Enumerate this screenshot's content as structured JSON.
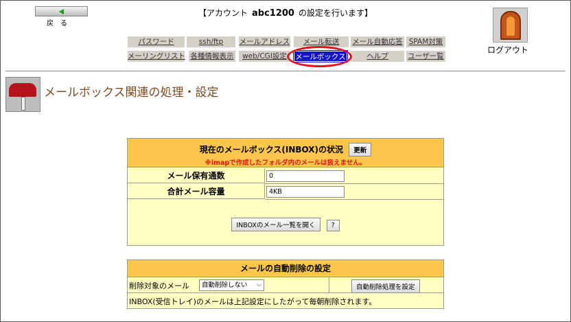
{
  "header": {
    "back_label": "戻る",
    "title_prefix": "【アカウント",
    "account": "abc1200",
    "title_suffix": "の設定を行います】",
    "logout_label": "ログアウト"
  },
  "nav": {
    "row1": [
      "パスワード",
      "ssh/ftp",
      "メールアドレス",
      "メール転送",
      "メール自動応答",
      "SPAM対策"
    ],
    "row2": [
      "メーリングリスト",
      "各種情報表示",
      "web/CGI設定",
      "メールボックス",
      "ヘルプ",
      "ユーザー覧"
    ]
  },
  "page": {
    "title": "メールボックス関連の処理・設定"
  },
  "status": {
    "title": "現在のメールボックス(INBOX)の状況",
    "refresh_label": "更新",
    "note": "※imapで作成したフォルダ内のメールは扱えません。",
    "count_label": "メール保有通数",
    "count_value": "0",
    "size_label": "合計メール容量",
    "size_value": "4KB",
    "list_button": "INBOXのメール一覧を開く",
    "help_button": "?"
  },
  "autodelete": {
    "title": "メールの自動削除の設定",
    "target_label": "削除対象のメール",
    "select_value": "自動削除しない",
    "apply_button": "自動削除処理を設定",
    "footer": "INBOX(受信トレイ)のメールは上記設定にしたがって毎朝削除されます。"
  },
  "colors": {
    "active_tab": "#1414c8",
    "header_bg": "#fcc64a",
    "panel_bg": "#ffffc4",
    "ring": "#e0141e",
    "note": "#e01414"
  }
}
